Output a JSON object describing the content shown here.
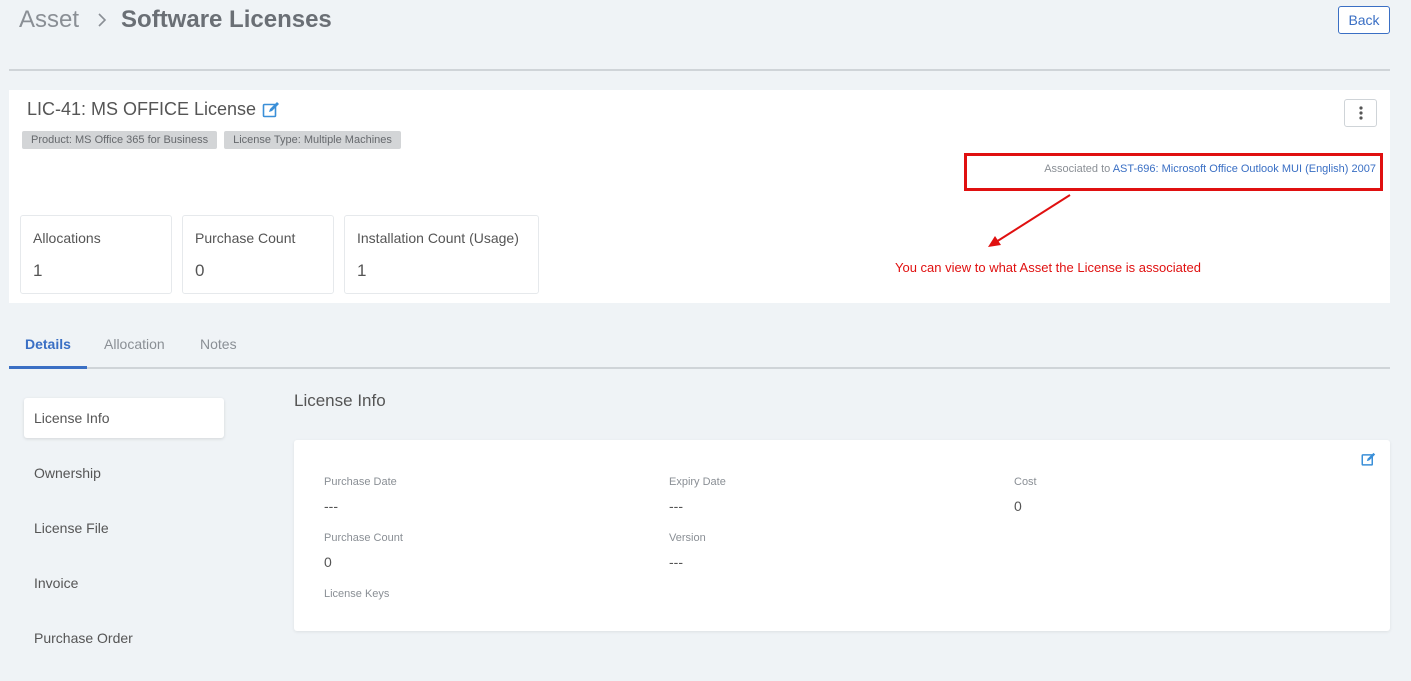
{
  "breadcrumb": {
    "root": "Asset",
    "current": "Software Licenses"
  },
  "actions": {
    "back_label": "Back"
  },
  "license": {
    "title": "LIC-41: MS OFFICE License",
    "tags": [
      "Product: MS Office 365 for Business",
      "License Type: Multiple Machines"
    ],
    "association": {
      "prefix": "Associated to",
      "link_text": "AST-696: Microsoft Office Outlook MUI (English) 2007"
    }
  },
  "annotation": {
    "text": "You can view to what Asset the License is associated"
  },
  "stats": [
    {
      "label": "Allocations",
      "value": "1"
    },
    {
      "label": "Purchase Count",
      "value": "0"
    },
    {
      "label": "Installation Count (Usage)",
      "value": "1"
    }
  ],
  "tabs": [
    {
      "label": "Details",
      "active": true
    },
    {
      "label": "Allocation",
      "active": false
    },
    {
      "label": "Notes",
      "active": false
    }
  ],
  "side_nav": [
    {
      "label": "License Info",
      "active": true
    },
    {
      "label": "Ownership",
      "active": false
    },
    {
      "label": "License File",
      "active": false
    },
    {
      "label": "Invoice",
      "active": false
    },
    {
      "label": "Purchase Order",
      "active": false
    }
  ],
  "section": {
    "title": "License Info"
  },
  "fields": {
    "purchase_date": {
      "label": "Purchase Date",
      "value": "---"
    },
    "expiry_date": {
      "label": "Expiry Date",
      "value": "---"
    },
    "cost": {
      "label": "Cost",
      "value": "0"
    },
    "purchase_count": {
      "label": "Purchase Count",
      "value": "0"
    },
    "version": {
      "label": "Version",
      "value": "---"
    },
    "license_keys": {
      "label": "License Keys"
    }
  },
  "colors": {
    "accent": "#3a6fc4",
    "annotation": "#e01010",
    "background": "#eff3f6"
  }
}
